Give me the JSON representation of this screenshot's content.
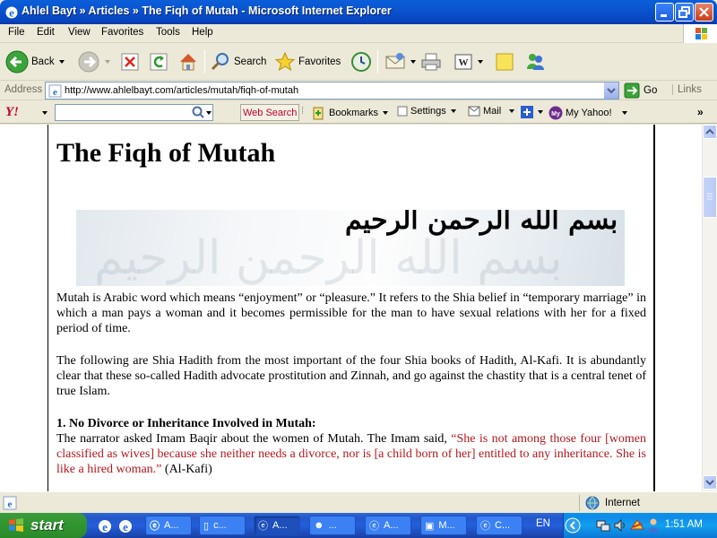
{
  "window": {
    "title": "Ahlel Bayt » Articles » The Fiqh of Mutah - Microsoft Internet Explorer"
  },
  "menu": [
    "File",
    "Edit",
    "View",
    "Favorites",
    "Tools",
    "Help"
  ],
  "toolbar": {
    "back_label": "Back",
    "search_label": "Search",
    "favorites_label": "Favorites"
  },
  "address": {
    "label": "Address",
    "url": "http://www.ahlelbayt.com/articles/mutah/fiqh-of-mutah",
    "go_label": "Go",
    "links_label": "Links"
  },
  "yahoo": {
    "logo": "Y!",
    "search_value": "",
    "web_search_label": "Web Search",
    "bookmarks_label": "Bookmarks",
    "settings_label": "Settings",
    "mail_label": "Mail",
    "my_yahoo_label": "My Yahoo!"
  },
  "article": {
    "title": "The Fiqh of Mutah",
    "banner_calligraphy": "بسم الله الرحمن الرحيم",
    "p1": "Mutah is Arabic word which means “enjoyment” or “pleasure.” It refers to the Shia belief in “temporary marriage” in which a man pays a woman and it becomes permissible for the man to have sexual relations with her for a fixed period of time.",
    "p2": "The following are Shia Hadith from the most important of the four Shia books of Hadith, Al-Kafi. It is abundantly clear that these so-called Hadith advocate prostitution and Zinnah, and go against the chastity that is a central tenet of true Islam.",
    "h1": "1. No Divorce or Inheritance Involved in Mutah:",
    "p3_lead": "The narrator asked Imam Baqir about the women of Mutah. The Imam said, ",
    "p3_quote": "“She is not among those four [women classified as wives] because she neither needs a divorce, nor is [a child born of her] entitled to any inheritance. She is like a hired woman.”",
    "p3_source": " (Al-Kafi)"
  },
  "status": {
    "zone": "Internet"
  },
  "taskbar": {
    "start_label": "start",
    "tasks": [
      "A...",
      "c...",
      "A...",
      "...",
      "A...",
      "M...",
      "C..."
    ],
    "language": "EN",
    "clock": "1:51 AM"
  },
  "colors": {
    "quote_red": "#b3171d",
    "title_bar_blue": "#0b54d0",
    "start_green": "#319631"
  }
}
